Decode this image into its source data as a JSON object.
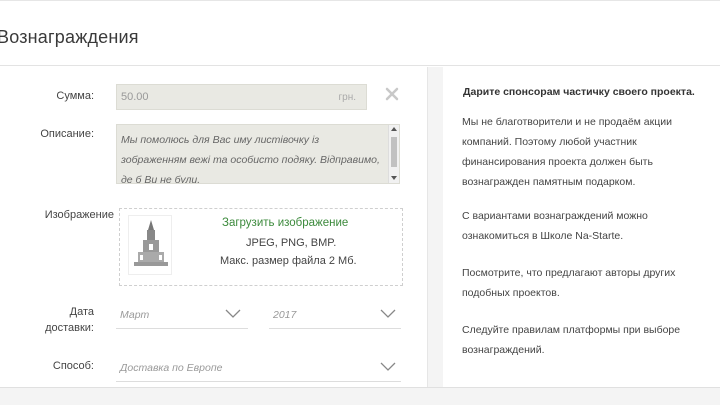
{
  "header": {
    "title": "Вознаграждения"
  },
  "form": {
    "sum": {
      "label": "Сумма:",
      "value": "50.00",
      "currency": "грн."
    },
    "description": {
      "label": "Описание:",
      "text": "Мы помолюсь для Вас иму листівочку із зображенням вежі та особисто подяку. Відправимо, де б Ви не були."
    },
    "image": {
      "label": "Изображение",
      "upload_label": "Загрузить изображение",
      "formats": "JPEG, PNG, BMP.",
      "max_size": "Макс. размер файла 2 Мб."
    },
    "delivery_date": {
      "label_line1": "Дата",
      "label_line2": "доставки:",
      "month": "Март",
      "year": "2017"
    },
    "method": {
      "label": "Способ:",
      "value": "Доставка по Европе"
    }
  },
  "info": {
    "title": "Дарите спонсорам частичку своего проекта.",
    "paragraphs": [
      "Мы не благотворители и не продаём акции компаний. Поэтому любой участник финансирования проекта должен быть вознагражден памятным подарком.",
      "С вариантами вознаграждений можно ознакомиться в Школе Na-Starte.",
      "Посмотрите, что предлагают авторы других подобных проектов.",
      "Следуйте правилам платформы при выборе вознаграждений."
    ]
  },
  "colors": {
    "link": "#3c8a3c",
    "field_bg": "#e9e9e3"
  }
}
